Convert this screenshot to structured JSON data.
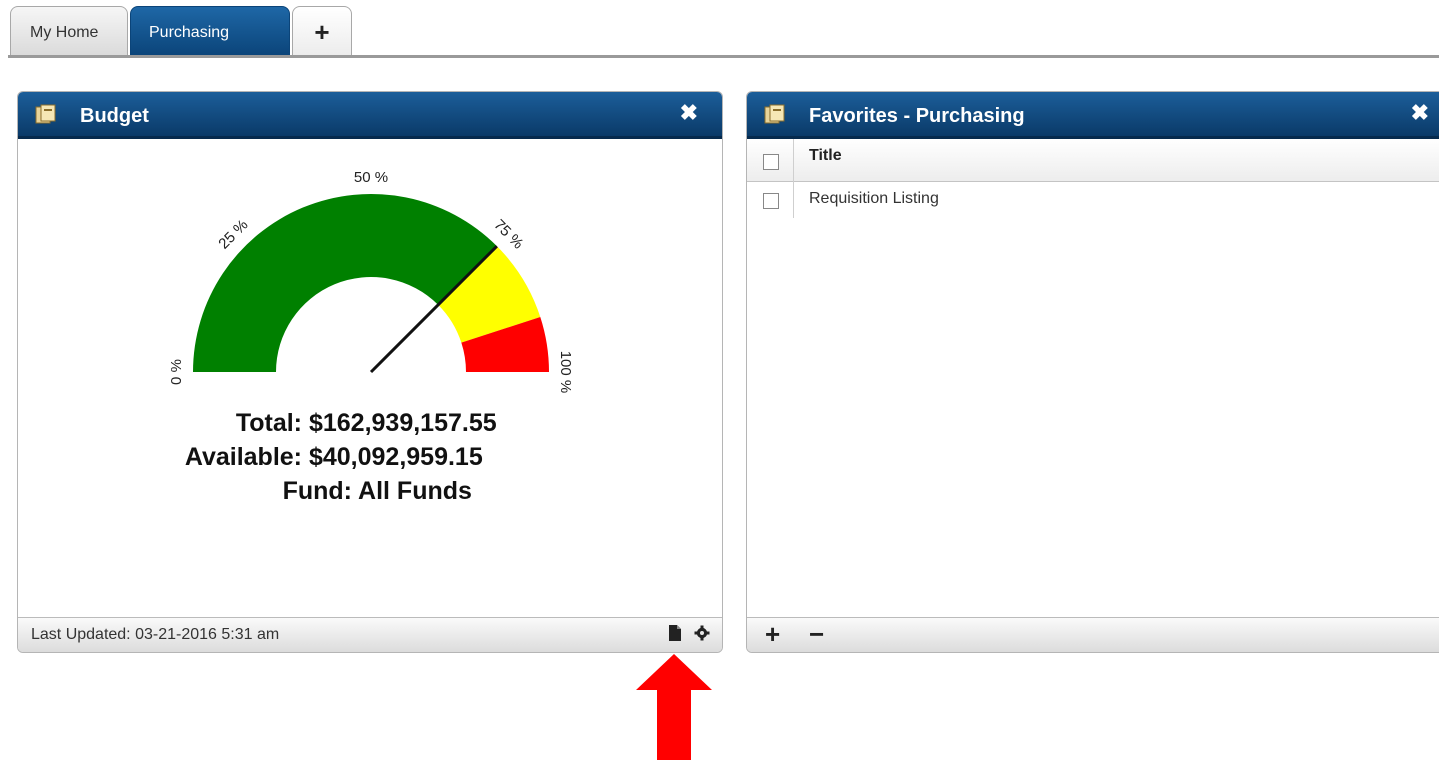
{
  "tabs": [
    {
      "label": "My Home",
      "active": false
    },
    {
      "label": "Purchasing",
      "active": true
    },
    {
      "label": "+",
      "icon": "plus-icon"
    }
  ],
  "budget_widget": {
    "title": "Budget",
    "icon": "widget-icon",
    "close_icon": "close-icon",
    "gauge": {
      "tick_labels": [
        "0 %",
        "25 %",
        "50 %",
        "75 %",
        "100 %"
      ],
      "bands": [
        {
          "from": 0,
          "to": 0.75,
          "color": "#008000"
        },
        {
          "from": 0.75,
          "to": 0.9,
          "color": "#ffff00"
        },
        {
          "from": 0.9,
          "to": 1.0,
          "color": "#ff0000"
        }
      ],
      "needle_value": 0.75
    },
    "total_label": "Total:",
    "total_value": "$162,939,157.55",
    "available_label": "Available:",
    "available_value": "$40,092,959.15",
    "fund_label": "Fund:",
    "fund_value": "All Funds",
    "footer_text": "Last Updated: 03-21-2016 5:31 am",
    "footer_icons": [
      "document-icon",
      "gear-icon"
    ]
  },
  "favorites_widget": {
    "title": "Favorites - Purchasing",
    "icon": "widget-icon",
    "close_icon": "close-icon",
    "column_header": "Title",
    "rows": [
      {
        "title": "Requisition Listing"
      }
    ],
    "footer_icons": [
      "plus-icon",
      "minus-icon"
    ]
  },
  "annotation": {
    "color": "#ff0000"
  }
}
